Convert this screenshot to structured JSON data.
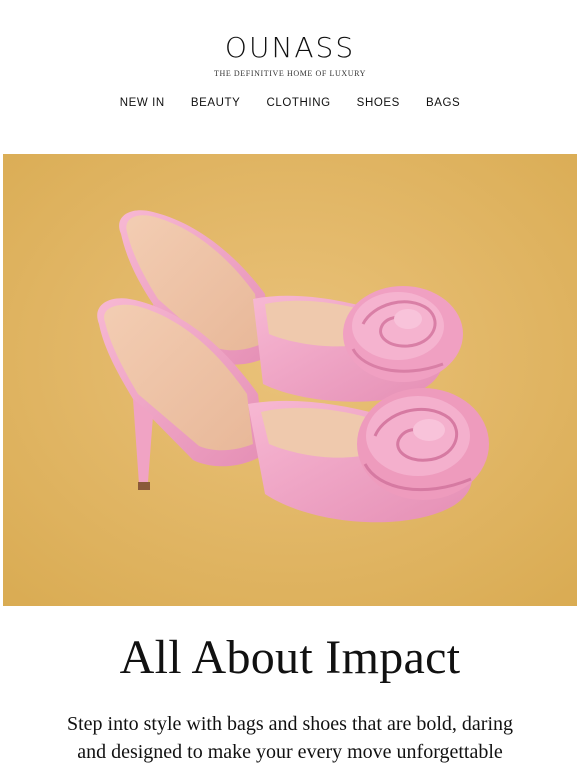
{
  "header": {
    "logo": "OUNASS",
    "tagline": "THE DEFINITIVE HOME OF LUXURY"
  },
  "nav": {
    "items": [
      {
        "label": "NEW IN"
      },
      {
        "label": "BEAUTY"
      },
      {
        "label": "CLOTHING"
      },
      {
        "label": "SHOES"
      },
      {
        "label": "BAGS"
      }
    ]
  },
  "hero": {
    "image_subject": "pink-satin-rose-heeled-mules",
    "background_color": "#e0b55e",
    "shoe_color": "#f0a3c4"
  },
  "content": {
    "headline": "All About Impact",
    "subtext_line1": "Step into style with bags and shoes that are bold, daring",
    "subtext_line2": "and designed to make your every move unforgettable"
  }
}
